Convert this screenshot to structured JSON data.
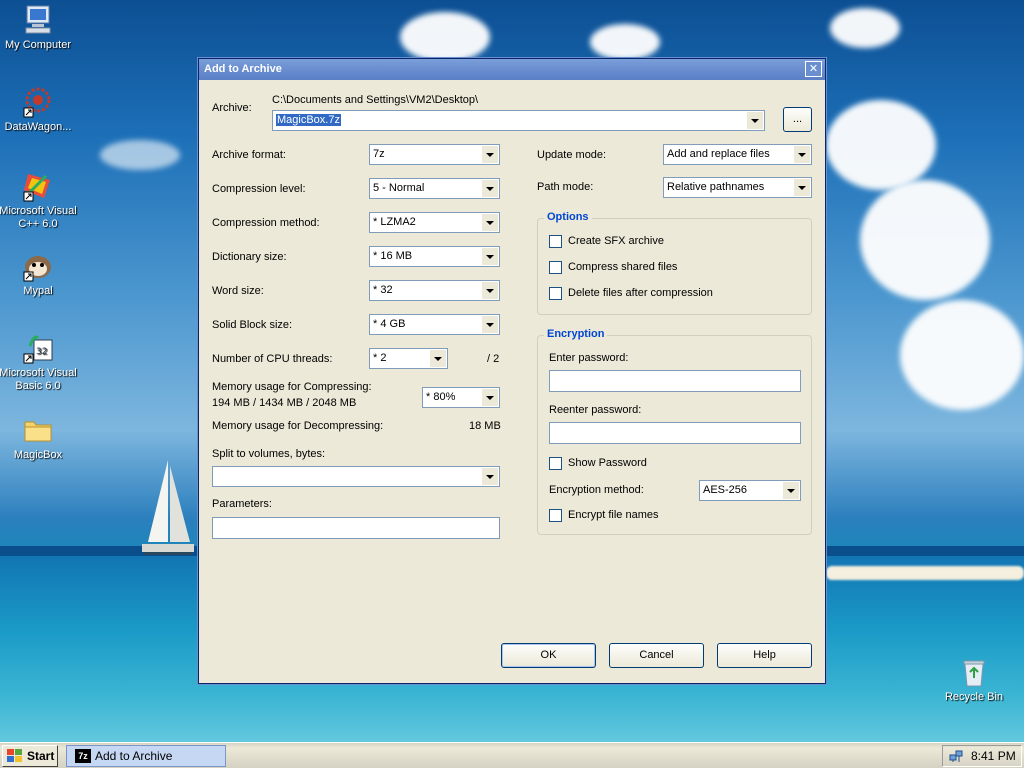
{
  "desktop": {
    "icons": [
      {
        "label": "My Computer"
      },
      {
        "label": "DataWagon..."
      },
      {
        "label": "Microsoft Visual C++ 6.0"
      },
      {
        "label": "Mypal"
      },
      {
        "label": "Microsoft Visual Basic 6.0"
      },
      {
        "label": "MagicBox"
      },
      {
        "label": "Recycle Bin"
      }
    ]
  },
  "dialog": {
    "title": "Add to Archive",
    "close_glyph": "✕",
    "archive": {
      "label": "Archive:",
      "path": "C:\\Documents and Settings\\VM2\\Desktop\\",
      "value": "MagicBox.7z",
      "browse_label": "..."
    },
    "left": {
      "archive_format": {
        "label": "Archive format:",
        "value": "7z"
      },
      "compression_level": {
        "label": "Compression level:",
        "value": "5 - Normal"
      },
      "compression_method": {
        "label": "Compression method:",
        "value": "* LZMA2"
      },
      "dictionary_size": {
        "label": "Dictionary size:",
        "value": "* 16 MB"
      },
      "word_size": {
        "label": "Word size:",
        "value": "* 32"
      },
      "solid_block_size": {
        "label": "Solid Block size:",
        "value": "* 4 GB"
      },
      "cpu_threads": {
        "label": "Number of CPU threads:",
        "value": "* 2",
        "max": "/ 2"
      },
      "mem_compress": {
        "label": "Memory usage for Compressing:",
        "detail": "194 MB / 1434 MB / 2048 MB",
        "value": "* 80%"
      },
      "mem_decompress": {
        "label": "Memory usage for Decompressing:",
        "value": "18 MB"
      },
      "split_volumes": {
        "label": "Split to volumes, bytes:",
        "value": ""
      },
      "parameters": {
        "label": "Parameters:",
        "value": ""
      }
    },
    "right": {
      "update_mode": {
        "label": "Update mode:",
        "value": "Add and replace files"
      },
      "path_mode": {
        "label": "Path mode:",
        "value": "Relative pathnames"
      },
      "options": {
        "title": "Options",
        "items": [
          {
            "label": "Create SFX archive",
            "checked": false
          },
          {
            "label": "Compress shared files",
            "checked": false
          },
          {
            "label": "Delete files after compression",
            "checked": false
          }
        ]
      },
      "encryption": {
        "title": "Encryption",
        "enter_password": {
          "label": "Enter password:",
          "value": ""
        },
        "reenter_password": {
          "label": "Reenter password:",
          "value": ""
        },
        "show_password": {
          "label": "Show Password",
          "checked": false
        },
        "method": {
          "label": "Encryption method:",
          "value": "AES-256"
        },
        "encrypt_names": {
          "label": "Encrypt file names",
          "checked": false
        }
      }
    },
    "buttons": {
      "ok": "OK",
      "cancel": "Cancel",
      "help": "Help"
    }
  },
  "taskbar": {
    "start_label": "Start",
    "task_label": "Add to Archive",
    "clock": "8:41 PM"
  }
}
